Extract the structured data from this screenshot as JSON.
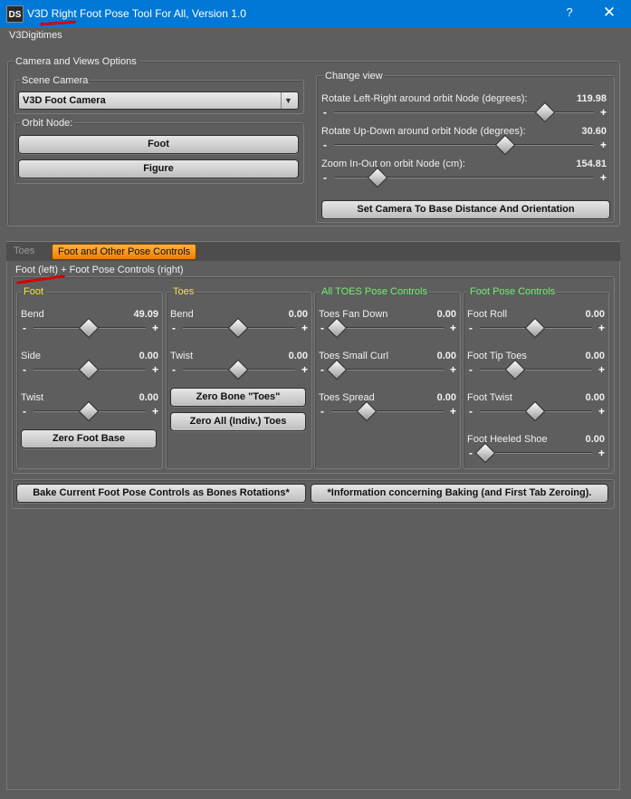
{
  "window": {
    "logo": "DS",
    "title": "V3D Right Foot Pose Tool For All, Version 1.0",
    "help": "?",
    "close": "✕",
    "subtitle": "V3Digitimes"
  },
  "camera_group": {
    "title": "Camera and Views Options",
    "scene_camera": {
      "title": "Scene Camera",
      "selected": "V3D Foot Camera",
      "arrow": "▼"
    },
    "orbit_node": {
      "title": "Orbit Node:",
      "buttons": [
        "Foot",
        "Figure"
      ]
    },
    "change_view": {
      "title": "Change view",
      "sliders": [
        {
          "label": "Rotate Left-Right around orbit Node (degrees):",
          "value": "119.98",
          "min": -180,
          "max": 180,
          "num": 119.98
        },
        {
          "label": "Rotate Up-Down around orbit Node (degrees):",
          "value": "30.60",
          "min": -90,
          "max": 90,
          "num": 30.6
        },
        {
          "label": "Zoom In-Out on orbit Node (cm):",
          "value": "154.81",
          "min": 0,
          "max": 1000,
          "num": 154.81
        }
      ],
      "reset_button": "Set Camera To Base Distance And Orientation"
    }
  },
  "tabs": {
    "inactive": "Toes",
    "active": "Foot and Other Pose Controls"
  },
  "pose_group": {
    "title": "Foot (left) + Foot Pose Controls (right)",
    "columns": [
      {
        "title": "Foot",
        "sliders": [
          {
            "label": "Bend",
            "value": "49.09",
            "pos": 0.5
          },
          {
            "label": "Side",
            "value": "0.00",
            "pos": 0.5
          },
          {
            "label": "Twist",
            "value": "0.00",
            "pos": 0.5
          }
        ],
        "buttons": [
          "Zero Foot Base"
        ]
      },
      {
        "title": "Toes",
        "sliders": [
          {
            "label": "Bend",
            "value": "0.00",
            "pos": 0.5
          },
          {
            "label": "Twist",
            "value": "0.00",
            "pos": 0.5
          }
        ],
        "buttons": [
          "Zero Bone \"Toes\"",
          "Zero All (Indiv.) Toes"
        ]
      },
      {
        "title": "All TOES Pose Controls",
        "sliders": [
          {
            "label": "Toes Fan Down",
            "value": "0.00",
            "pos": 0.0
          },
          {
            "label": "Toes Small Curl",
            "value": "0.00",
            "pos": 0.0
          },
          {
            "label": "Toes Spread",
            "value": "0.00",
            "pos": 0.3
          }
        ],
        "buttons": []
      },
      {
        "title": "Foot Pose Controls",
        "sliders": [
          {
            "label": "Foot Roll",
            "value": "0.00",
            "pos": 0.5
          },
          {
            "label": "Foot Tip Toes",
            "value": "0.00",
            "pos": 0.3
          },
          {
            "label": "Foot Twist",
            "value": "0.00",
            "pos": 0.5
          },
          {
            "label": "Foot Heeled Shoe",
            "value": "0.00",
            "pos": 0.0
          }
        ],
        "buttons": []
      }
    ]
  },
  "bottom_buttons": [
    "Bake Current Foot Pose Controls as Bones Rotations*",
    "*Information concerning Baking (and First Tab Zeroing)."
  ],
  "colors": {
    "titlebar": "#0078d7",
    "tab_active": "#f08000",
    "annotation": "#d40000",
    "col_title_yellow": "#f3e43a",
    "col_title_green": "#6ef06e"
  }
}
